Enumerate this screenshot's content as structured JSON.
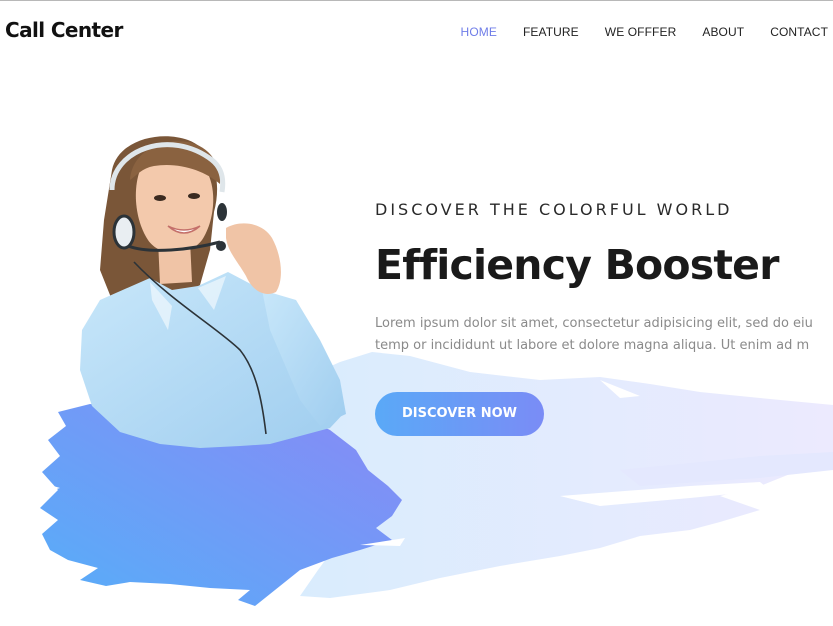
{
  "brand": {
    "name": "Call Center"
  },
  "nav": {
    "items": [
      {
        "label": "HOME",
        "active": true
      },
      {
        "label": "FEATURE",
        "active": false
      },
      {
        "label": "WE OFFFER",
        "active": false
      },
      {
        "label": "ABOUT",
        "active": false
      },
      {
        "label": "CONTACT",
        "active": false
      }
    ]
  },
  "hero": {
    "eyebrow": "DISCOVER THE COLORFUL WORLD",
    "title": "Efficiency Booster",
    "body_line1": "Lorem ipsum dolor sit amet, consectetur adipisicing elit, sed do eiu",
    "body_line2": "temp or incididunt ut labore et dolore magna aliqua. Ut enim ad m",
    "cta_label": "DISCOVER NOW",
    "image": "call-center-agent-with-headset"
  },
  "colors": {
    "accent": "#6f7de8",
    "button_start": "#5aa9f7",
    "button_end": "#7a8cf6",
    "brush_light": "#e8ecfe",
    "brush_blue": "#5fa8f7"
  }
}
